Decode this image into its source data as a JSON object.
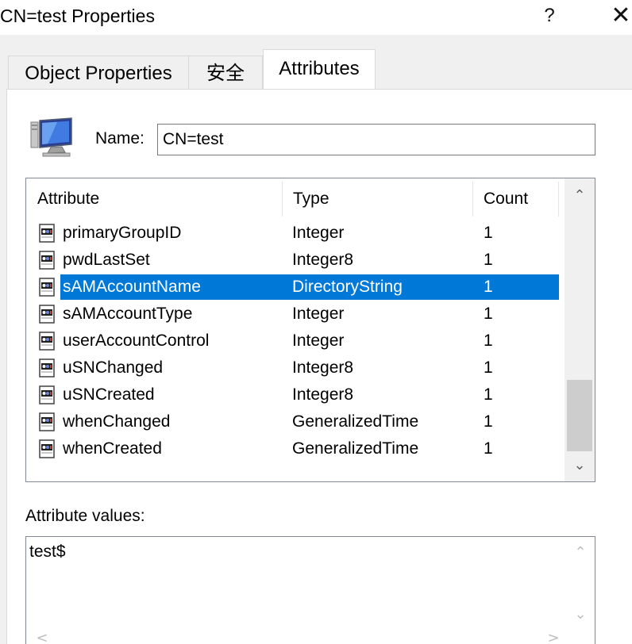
{
  "window": {
    "title": "CN=test Properties",
    "help_glyph": "?",
    "close_glyph": "✕"
  },
  "tabs": [
    {
      "label": "Object Properties",
      "active": false
    },
    {
      "label": "安全",
      "active": false
    },
    {
      "label": "Attributes",
      "active": true
    }
  ],
  "object": {
    "icon": "computer-icon",
    "name_label": "Name:",
    "name_value": "CN=test"
  },
  "attribute_list": {
    "columns": [
      "Attribute",
      "Type",
      "Count"
    ],
    "row_icon": "attribute-icon",
    "rows": [
      {
        "attribute": "primaryGroupID",
        "type": "Integer",
        "count": "1",
        "selected": false
      },
      {
        "attribute": "pwdLastSet",
        "type": "Integer8",
        "count": "1",
        "selected": false
      },
      {
        "attribute": "sAMAccountName",
        "type": "DirectoryString",
        "count": "1",
        "selected": true
      },
      {
        "attribute": "sAMAccountType",
        "type": "Integer",
        "count": "1",
        "selected": false
      },
      {
        "attribute": "userAccountControl",
        "type": "Integer",
        "count": "1",
        "selected": false
      },
      {
        "attribute": "uSNChanged",
        "type": "Integer8",
        "count": "1",
        "selected": false
      },
      {
        "attribute": "uSNCreated",
        "type": "Integer8",
        "count": "1",
        "selected": false
      },
      {
        "attribute": "whenChanged",
        "type": "GeneralizedTime",
        "count": "1",
        "selected": false
      },
      {
        "attribute": "whenCreated",
        "type": "GeneralizedTime",
        "count": "1",
        "selected": false
      }
    ],
    "selection_color": "#0078d7"
  },
  "scroll": {
    "up_glyph": "⌃",
    "down_glyph": "⌄",
    "left_glyph": "<",
    "right_glyph": ">"
  },
  "values": {
    "label": "Attribute values:",
    "content": "test$"
  }
}
